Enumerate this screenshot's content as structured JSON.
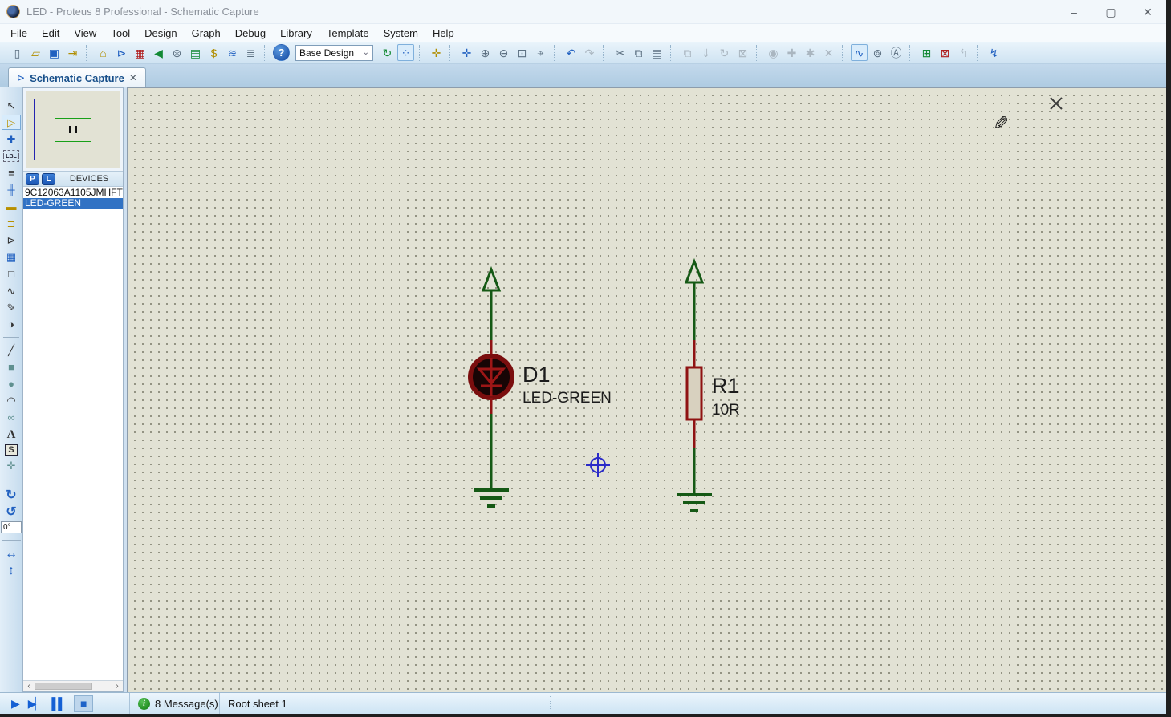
{
  "titlebar": {
    "title": "LED - Proteus 8 Professional - Schematic Capture",
    "minimize": "–",
    "maximize": "▢",
    "close": "✕"
  },
  "menubar": {
    "items": [
      {
        "label": "File"
      },
      {
        "label": "Edit"
      },
      {
        "label": "View"
      },
      {
        "label": "Tool"
      },
      {
        "label": "Design"
      },
      {
        "label": "Graph"
      },
      {
        "label": "Debug"
      },
      {
        "label": "Library"
      },
      {
        "label": "Template"
      },
      {
        "label": "System"
      },
      {
        "label": "Help"
      }
    ]
  },
  "toolbar": {
    "design_selector": {
      "value": "Base Design",
      "chevron": "⌄"
    },
    "left_icons": [
      {
        "name": "new-project-icon",
        "glyph": "▯",
        "cls": "c-gray",
        "inter": true
      },
      {
        "name": "open-project-icon",
        "glyph": "▱",
        "cls": "yellow",
        "inter": true
      },
      {
        "name": "save-project-icon",
        "glyph": "▣",
        "cls": "c-blue",
        "inter": true
      },
      {
        "name": "import-legacy-icon",
        "glyph": "⇥",
        "cls": "olive",
        "inter": true
      },
      {
        "name": "toolbar-separator",
        "glyph": "",
        "cls": "sep",
        "inter": false
      },
      {
        "name": "home-page-icon",
        "glyph": "⌂",
        "cls": "olive",
        "inter": true
      },
      {
        "name": "schematic-capture-icon",
        "glyph": "⊳",
        "cls": "c-blue",
        "inter": true
      },
      {
        "name": "pcb-layout-icon",
        "glyph": "▦",
        "cls": "c-red",
        "inter": true
      },
      {
        "name": "3d-visualizer-icon",
        "glyph": "◀",
        "cls": "c-green",
        "inter": true
      },
      {
        "name": "gerber-viewer-icon",
        "glyph": "⊛",
        "cls": "c-gray",
        "inter": true
      },
      {
        "name": "design-explorer-icon",
        "glyph": "▤",
        "cls": "c-green",
        "inter": true
      },
      {
        "name": "bill-of-materials-icon",
        "glyph": "$",
        "cls": "olive",
        "inter": true
      },
      {
        "name": "electrical-rule-check-icon",
        "glyph": "≋",
        "cls": "c-blue",
        "inter": true
      },
      {
        "name": "project-notes-icon",
        "glyph": "≣",
        "cls": "c-gray",
        "inter": true
      },
      {
        "name": "toolbar-separator",
        "glyph": "",
        "cls": "sep",
        "inter": false
      },
      {
        "name": "help-icon",
        "glyph": "?",
        "cls": "help",
        "inter": true
      }
    ],
    "right_icons": [
      {
        "name": "refresh-display-icon",
        "glyph": "↻",
        "cls": "c-green",
        "inter": true
      },
      {
        "name": "grid-toggle-icon",
        "glyph": "⁘",
        "cls": "on",
        "inter": true
      },
      {
        "name": "toolbar-separator",
        "glyph": "",
        "cls": "sep",
        "inter": false
      },
      {
        "name": "false-origin-icon",
        "glyph": "✛",
        "cls": "olive",
        "inter": true
      },
      {
        "name": "toolbar-separator",
        "glyph": "",
        "cls": "sep",
        "inter": false
      },
      {
        "name": "center-at-cursor-icon",
        "glyph": "✛",
        "cls": "c-blue",
        "inter": true
      },
      {
        "name": "zoom-in-icon",
        "glyph": "⊕",
        "cls": "c-gray",
        "inter": true
      },
      {
        "name": "zoom-out-icon",
        "glyph": "⊖",
        "cls": "c-gray",
        "inter": true
      },
      {
        "name": "zoom-to-area-icon",
        "glyph": "⊡",
        "cls": "c-gray",
        "inter": true
      },
      {
        "name": "zoom-to-sheet-icon",
        "glyph": "⌖",
        "cls": "c-gray",
        "inter": true
      },
      {
        "name": "toolbar-separator",
        "glyph": "",
        "cls": "sep",
        "inter": false
      },
      {
        "name": "undo-icon",
        "glyph": "↶",
        "cls": "c-blue",
        "inter": true
      },
      {
        "name": "redo-icon",
        "glyph": "↷",
        "cls": "dim",
        "inter": true
      },
      {
        "name": "toolbar-separator",
        "glyph": "",
        "cls": "sep",
        "inter": false
      },
      {
        "name": "cut-icon",
        "glyph": "✂",
        "cls": "c-gray",
        "inter": true
      },
      {
        "name": "copy-icon",
        "glyph": "⧉",
        "cls": "c-gray",
        "inter": true
      },
      {
        "name": "paste-icon",
        "glyph": "▤",
        "cls": "c-gray",
        "inter": true
      },
      {
        "name": "toolbar-separator",
        "glyph": "",
        "cls": "sep",
        "inter": false
      },
      {
        "name": "block-copy-icon",
        "glyph": "⧉",
        "cls": "dim",
        "inter": true
      },
      {
        "name": "block-move-icon",
        "glyph": "⇓",
        "cls": "dim",
        "inter": true
      },
      {
        "name": "block-rotate-icon",
        "glyph": "↻",
        "cls": "dim",
        "inter": true
      },
      {
        "name": "block-delete-icon",
        "glyph": "⊠",
        "cls": "dim",
        "inter": true
      },
      {
        "name": "toolbar-separator",
        "glyph": "",
        "cls": "sep",
        "inter": false
      },
      {
        "name": "pick-parts-icon",
        "glyph": "◉",
        "cls": "dim",
        "inter": true
      },
      {
        "name": "make-device-icon",
        "glyph": "✚",
        "cls": "dim",
        "inter": true
      },
      {
        "name": "packaging-tool-icon",
        "glyph": "✱",
        "cls": "dim",
        "inter": true
      },
      {
        "name": "decompose-icon",
        "glyph": "✕",
        "cls": "dim",
        "inter": true
      },
      {
        "name": "toolbar-separator",
        "glyph": "",
        "cls": "sep",
        "inter": false
      },
      {
        "name": "wire-autorouter-icon",
        "glyph": "∿",
        "cls": "on",
        "inter": true
      },
      {
        "name": "search-and-tag-icon",
        "glyph": "⊚",
        "cls": "c-gray",
        "inter": true
      },
      {
        "name": "property-assignment-icon",
        "glyph": "Ⓐ",
        "cls": "c-gray",
        "inter": true
      },
      {
        "name": "toolbar-separator",
        "glyph": "",
        "cls": "sep",
        "inter": false
      },
      {
        "name": "new-root-sheet-icon",
        "glyph": "⊞",
        "cls": "c-green",
        "inter": true
      },
      {
        "name": "remove-sheet-icon",
        "glyph": "⊠",
        "cls": "c-red",
        "inter": true
      },
      {
        "name": "goto-sheet-icon",
        "glyph": "↰",
        "cls": "dim",
        "inter": true
      },
      {
        "name": "toolbar-separator",
        "glyph": "",
        "cls": "sep",
        "inter": false
      },
      {
        "name": "electrical-check-report-icon",
        "glyph": "↯",
        "cls": "c-blue",
        "inter": true
      }
    ]
  },
  "tabbar": {
    "tab": {
      "label": "Schematic Capture",
      "icon_glyph": "⊳",
      "close_glyph": "✕"
    }
  },
  "sidebar": {
    "tools": [
      {
        "name": "selection-mode-icon",
        "glyph": "↖",
        "cls": "",
        "inter": true
      },
      {
        "name": "component-mode-icon",
        "glyph": "▷",
        "cls": "sel",
        "inter": true
      },
      {
        "name": "junction-dot-mode-icon",
        "glyph": "✚",
        "cls": "blue",
        "inter": true
      },
      {
        "name": "wire-label-mode-icon",
        "glyph": "LBL",
        "cls": "lbl",
        "inter": true
      },
      {
        "name": "text-script-mode-icon",
        "glyph": "≡",
        "cls": "",
        "inter": true
      },
      {
        "name": "buses-mode-icon",
        "glyph": "╫",
        "cls": "blue",
        "inter": true
      },
      {
        "name": "subcircuit-mode-icon",
        "glyph": "▬",
        "cls": "yellow",
        "inter": true
      },
      {
        "name": "terminals-mode-icon",
        "glyph": "⊐",
        "cls": "yellow",
        "inter": true
      },
      {
        "name": "device-pins-mode-icon",
        "glyph": "⊳",
        "cls": "",
        "inter": true
      },
      {
        "name": "graph-mode-icon",
        "glyph": "▦",
        "cls": "blue",
        "inter": true
      },
      {
        "name": "tape-recorder-mode-icon",
        "glyph": "□",
        "cls": "",
        "inter": true
      },
      {
        "name": "generator-mode-icon",
        "glyph": "∿",
        "cls": "",
        "inter": true
      },
      {
        "name": "voltage-probe-mode-icon",
        "glyph": "✎",
        "cls": "",
        "inter": true
      },
      {
        "name": "virtual-instruments-mode-icon",
        "glyph": "◑",
        "cls": "",
        "inter": true
      },
      {
        "name": "tools-divider",
        "glyph": "",
        "cls": "divider",
        "inter": false
      },
      {
        "name": "2d-line-mode-icon",
        "glyph": "╱",
        "cls": "",
        "inter": true
      },
      {
        "name": "2d-box-mode-icon",
        "glyph": "■",
        "cls": "teal",
        "inter": true
      },
      {
        "name": "2d-circle-mode-icon",
        "glyph": "●",
        "cls": "teal",
        "inter": true
      },
      {
        "name": "2d-arc-mode-icon",
        "glyph": "◠",
        "cls": "",
        "inter": true
      },
      {
        "name": "2d-path-mode-icon",
        "glyph": "∞",
        "cls": "teal",
        "inter": true
      },
      {
        "name": "2d-text-mode-icon",
        "glyph": "A",
        "cls": "serif",
        "inter": true
      },
      {
        "name": "2d-symbol-mode-icon",
        "glyph": "S",
        "cls": "boxed",
        "inter": true
      },
      {
        "name": "2d-marker-mode-icon",
        "glyph": "✛",
        "cls": "teal",
        "inter": true
      }
    ],
    "rotate_tools": [
      {
        "name": "rotate-clockwise-icon",
        "glyph": "↻",
        "cls": "big blue",
        "inter": true
      },
      {
        "name": "rotate-anticlockwise-icon",
        "glyph": "↺",
        "cls": "big blue",
        "inter": true
      }
    ],
    "angle_value": "0°",
    "mirror_tools": [
      {
        "name": "mirror-horizontal-icon",
        "glyph": "↔",
        "cls": "big blue",
        "inter": true
      },
      {
        "name": "mirror-vertical-icon",
        "glyph": "↕",
        "cls": "big blue",
        "inter": true
      }
    ]
  },
  "devices_panel": {
    "pick_button": "P",
    "library_button": "L",
    "header": "DEVICES",
    "items": [
      {
        "label": "9C12063A1105JMHFT",
        "cls": ""
      },
      {
        "label": "LED-GREEN",
        "cls": "selected"
      }
    ],
    "scroll_left": "‹",
    "scroll_right": "›"
  },
  "schematic": {
    "components": [
      {
        "ref": "D1",
        "value": "LED-GREEN"
      },
      {
        "ref": "R1",
        "value": "10R"
      }
    ],
    "colors": {
      "wire_green": "#155915",
      "pin_red": "#8f1212",
      "label": "#1c1c1c",
      "origin_blue": "#2b2bc8"
    }
  },
  "statusbar": {
    "sim_buttons": [
      {
        "name": "play-button",
        "glyph": "▶",
        "cls": "",
        "inter": true
      },
      {
        "name": "step-button",
        "glyph": "▶▏",
        "cls": "",
        "inter": true
      },
      {
        "name": "pause-button",
        "glyph": "▌▌",
        "cls": "",
        "inter": true
      },
      {
        "name": "stop-button",
        "glyph": "■",
        "cls": "stop",
        "inter": true
      }
    ],
    "info_glyph": "i",
    "messages": "8 Message(s)",
    "sheet": "Root sheet 1"
  }
}
